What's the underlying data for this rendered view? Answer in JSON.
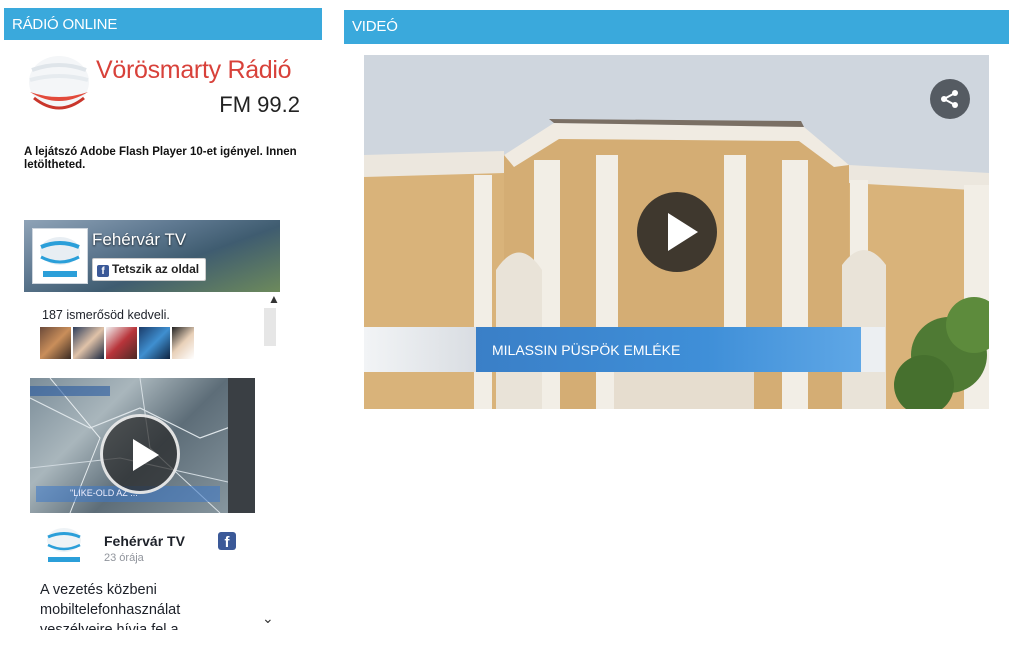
{
  "radio": {
    "header": "RÁDIÓ ONLINE",
    "logo_name": "Vörösmarty Rádió",
    "logo_freq": "FM 99.2",
    "flash_note": "A lejátszó Adobe Flash Player 10-et igényel. Innen letöltheted."
  },
  "facebook": {
    "page_name": "Fehérvár TV",
    "like_label": "Tetszik az oldal",
    "friends_text": "187 ismerősöd kedveli.",
    "video_caption": "\"LIKE-OLD AZ ...",
    "post": {
      "author": "Fehérvár TV",
      "time": "23 órája",
      "text": "A vezetés közbeni mobiltelefonhasználat veszélyeire hívja fel a"
    }
  },
  "video": {
    "header": "VIDEÓ",
    "title": "MILASSIN PÜSPÖK EMLÉKE"
  },
  "colors": {
    "header_blue": "#3aa9dc",
    "facebook_blue": "#3b5998",
    "radio_red": "#d8413a"
  }
}
